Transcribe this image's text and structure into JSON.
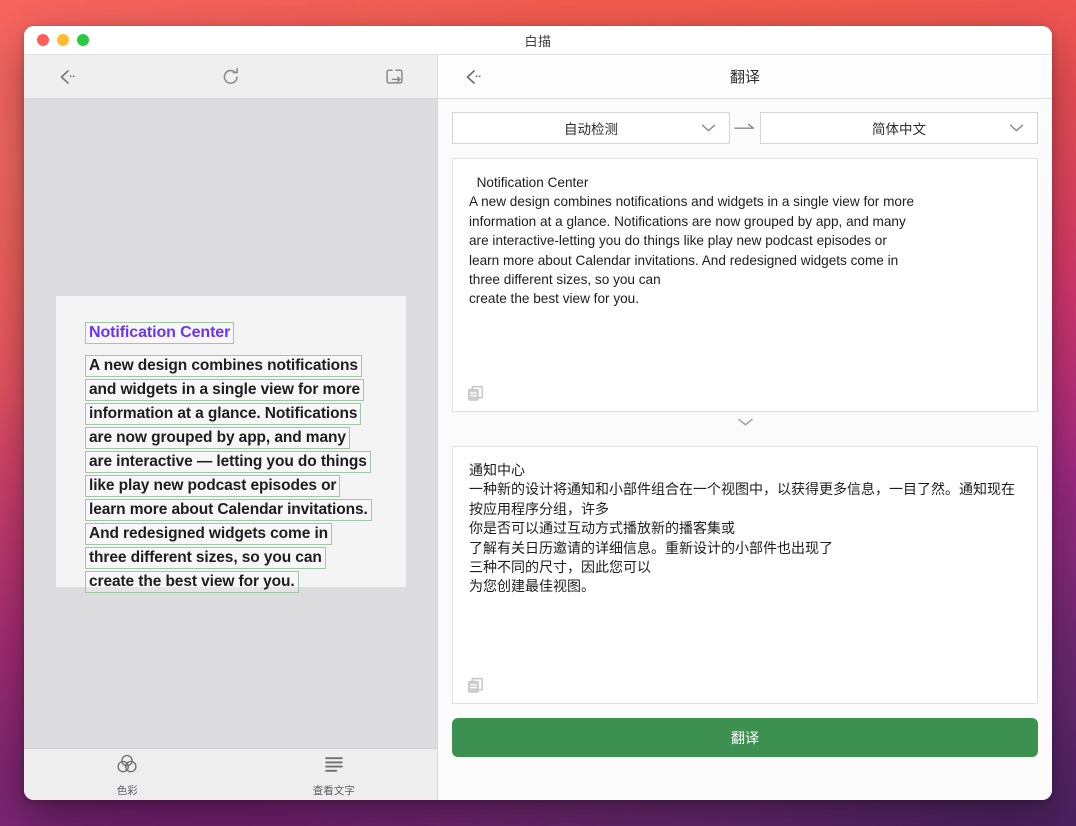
{
  "window": {
    "title": "白描",
    "traffic_lights": [
      {
        "name": "close",
        "color": "#ff5f57"
      },
      {
        "name": "minimize",
        "color": "#febc2e"
      },
      {
        "name": "zoom",
        "color": "#28c840"
      }
    ]
  },
  "left_pane": {
    "toolbar": {
      "back_icon": "back-chevron-icon",
      "refresh_icon": "refresh-icon",
      "export_icon": "export-icon"
    },
    "ocr": {
      "title": "Notification Center",
      "title_color": "#6b34f0",
      "box_border_color": "#9ec8a5",
      "lines": [
        "A new design combines notifications",
        "and widgets in a single view for more",
        "information at a glance. Notifications",
        "are now grouped by app, and many",
        "are interactive — letting you do things",
        "like play new podcast episodes or",
        "learn more about Calendar invitations.",
        "And redesigned widgets come in",
        "three different sizes, so you can",
        "create the best view for you."
      ]
    },
    "tabs": [
      {
        "label": "色彩",
        "icon": "venn-circles-icon",
        "active": false
      },
      {
        "label": "查看文字",
        "icon": "text-lines-icon",
        "active": false
      }
    ]
  },
  "right_pane": {
    "header": {
      "back_icon": "back-chevron-icon",
      "page_title": "翻译"
    },
    "language": {
      "source": "自动检测",
      "target": "简体中文",
      "arrow_icon": "arrow-right-icon",
      "chevron_icon": "chevron-down-icon"
    },
    "source_text": "  Notification Center\nA new design combines notifications and widgets in a single view for more\ninformation at a glance. Notifications are now grouped by app, and many\nare interactive-letting you do things like play new podcast episodes or\nlearn more about Calendar invitations. And redesigned widgets come in\nthree different sizes, so you can\ncreate the best view for you.",
    "target_text": "通知中心\n一种新的设计将通知和小部件组合在一个视图中，以获得更多信息，一目了然。通知现在按应用程序分组，许多\n你是否可以通过互动方式播放新的播客集或\n了解有关日历邀请的详细信息。重新设计的小部件也出现了\n三种不同的尺寸，因此您可以\n为您创建最佳视图。",
    "copy_icon": "copy-icon",
    "collapse_icon": "chevron-down-icon",
    "translate_button": {
      "label": "翻译",
      "color": "#3d9150"
    }
  }
}
